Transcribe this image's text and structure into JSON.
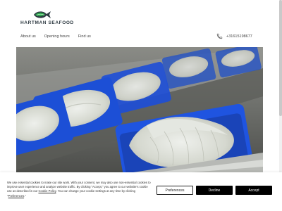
{
  "brand": {
    "name": "HARTMAN SEAFOOD",
    "accent": "#2aa84a",
    "fish_color": "#2f3b43"
  },
  "nav": {
    "items": [
      {
        "label": "About us"
      },
      {
        "label": "Opening hours"
      },
      {
        "label": "Find us"
      }
    ]
  },
  "contact": {
    "phone": "+31615198677",
    "icon": "phone-icon"
  },
  "hero": {
    "image": "seafood-fillets-on-conveyor"
  },
  "cookie_banner": {
    "text_before_link": "We use essential cookies to make our site work. With your consent, we may also use non-essential cookies to improve user experience and analyze website traffic. By clicking \"Accept,\" you agree to our website's cookie use as described in our ",
    "link_cookie_policy": "Cookie Policy",
    "text_middle": ". You can change your cookie settings at any time by clicking \"",
    "link_preferences": "Preferences",
    "text_end": ".\"",
    "preferences_label": "Preferences",
    "decline_label": "Decline",
    "accept_label": "Accept"
  }
}
